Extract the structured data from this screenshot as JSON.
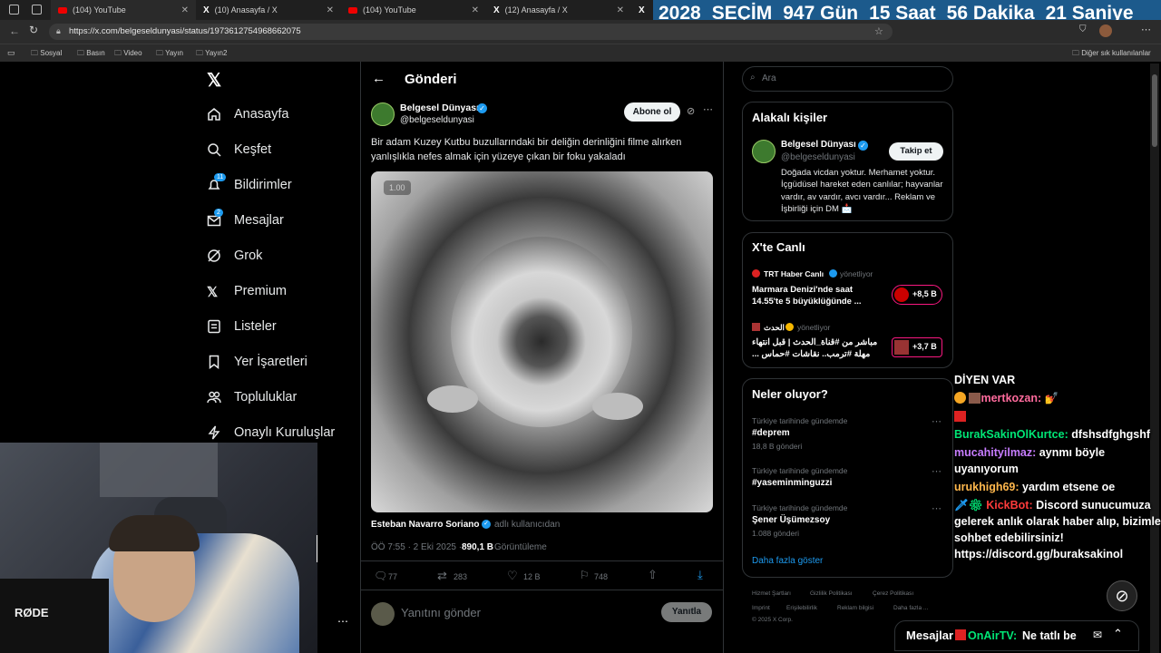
{
  "browser": {
    "tabs": [
      {
        "title": "(104) YouTube"
      },
      {
        "title": "(10) Anasayfa / X"
      },
      {
        "title": "(104) YouTube"
      },
      {
        "title": "(12) Anasayfa / X"
      }
    ],
    "url": "https://x.com/belgeseldunyasi/status/1973612754968662075",
    "bookmarks": [
      "Sosyal",
      "Basın",
      "Video",
      "Yayın",
      "Yayın2"
    ],
    "other_bookmarks": "Diğer sık kullanılanlar"
  },
  "countdown": {
    "year": "2028",
    "label": "SEÇİM",
    "days": "947 Gün",
    "hours": "15 Saat",
    "minutes": "56 Dakika",
    "seconds": "21 Saniye"
  },
  "sidebar": {
    "items": [
      {
        "label": "Anasayfa",
        "icon": "home-icon"
      },
      {
        "label": "Keşfet",
        "icon": "search-icon"
      },
      {
        "label": "Bildirimler",
        "icon": "bell-icon",
        "badge": "11"
      },
      {
        "label": "Mesajlar",
        "icon": "mail-icon",
        "badge": "2"
      },
      {
        "label": "Grok",
        "icon": "grok-icon"
      },
      {
        "label": "Premium",
        "icon": "x-icon"
      },
      {
        "label": "Listeler",
        "icon": "list-icon"
      },
      {
        "label": "Yer İşaretleri",
        "icon": "bookmark-icon"
      },
      {
        "label": "Topluluklar",
        "icon": "people-icon"
      },
      {
        "label": "Onaylı Kuruluşlar",
        "icon": "bolt-icon"
      }
    ]
  },
  "post": {
    "header": "Gönderi",
    "author_name": "Belgesel Dünyası",
    "author_handle": "@belgeseldunyasi",
    "subscribe_label": "Abone ol",
    "text": "Bir adam Kuzey Kutbu buzullarındaki bir deliğin derinliğini filme alırken yanlışlıkla nefes almak için yüzeye çıkan bir foku yakaladı",
    "video_time": "1.00",
    "credit_name": "Esteban Navarro Soriano",
    "credit_suffix": "adlı kullanıcıdan",
    "timestamp": "ÖÖ 7:55 · 2 Eki 2025 ·",
    "views": "890,1 B",
    "views_label": "Görüntüleme",
    "replies": "77",
    "reposts": "283",
    "likes": "12 B",
    "bookmarks": "748",
    "reply_placeholder": "Yanıtını gönder",
    "reply_button": "Yanıtla"
  },
  "right": {
    "search_placeholder": "Ara",
    "related_title": "Alakalı kişiler",
    "related_name": "Belgesel Dünyası",
    "related_handle": "@belgeseldunyasi",
    "follow_label": "Takip et",
    "related_bio": "Doğada vicdan yoktur. Merhamet yoktur. İçgüdüsel hareket eden canlılar; hayvanlar vardır, av vardır, avcı vardır... Reklam ve İşbirliği için DM 📩",
    "live_title": "X'te Canlı",
    "live": [
      {
        "host": "TRT Haber Canlı",
        "role": "yönetliyor",
        "title": "Marmara Denizi'nde saat 14.55'te 5 büyüklüğünde ...",
        "count": "+8,5 B"
      },
      {
        "host": "الحدث",
        "role": "yönetliyor",
        "title": "مباشر من #قناة_الحدث | قبل انتهاء مهلة #ترمب.. نقاشات #حماس ...",
        "count": "+3,7 B"
      }
    ],
    "trends_title": "Neler oluyor?",
    "trends": [
      {
        "context": "Türkiye tarihinde gündemde",
        "name": "#deprem",
        "count": "18,8 B gönderi"
      },
      {
        "context": "Türkiye tarihinde gündemde",
        "name": "#yaseminminguzzi",
        "count": ""
      },
      {
        "context": "Türkiye tarihinde gündemde",
        "name": "Şener Üşümezsoy",
        "count": "1.088 gönderi"
      }
    ],
    "show_more": "Daha fazla göster",
    "footer_links": [
      "Hizmet Şartları",
      "Gizlilik Politikası",
      "Çerez Politikası",
      "Imprint",
      "Erişilebilirlik",
      "Reklam bilgisi",
      "Daha fazla ..."
    ],
    "copyright": "© 2025 X Corp."
  },
  "chat": {
    "header": "DİYEN VAR",
    "messages": [
      {
        "user": "mertkozan:",
        "text": "",
        "color": "#ff6b9d"
      },
      {
        "user": "",
        "text": "",
        "color": "#ff3b3b"
      },
      {
        "user": "BurakSakinOlKurtce:",
        "text": "dfshsdfghgshf",
        "color": "#00e676"
      },
      {
        "user": "mucahityilmaz:",
        "text": "aynmı böyle uyanıyorum",
        "color": "#c77dff"
      },
      {
        "user": "urukhigh69:",
        "text": "yardım etsene oe",
        "color": "#ffb84d"
      },
      {
        "user": "KickBot:",
        "text": "Discord sunucumuza gelerek anlık olarak haber alıp, bizimle sohbet edebilirsiniz! https://discord.gg/buraksakinol",
        "color": "#ff3b3b"
      },
      {
        "user": "OnAirTV:",
        "text": "Ne tatlı be",
        "color": "#00e676"
      }
    ]
  },
  "messages_bar": {
    "label": "Mesajlar"
  },
  "webcam": {
    "mic_brand": "RØDE"
  }
}
